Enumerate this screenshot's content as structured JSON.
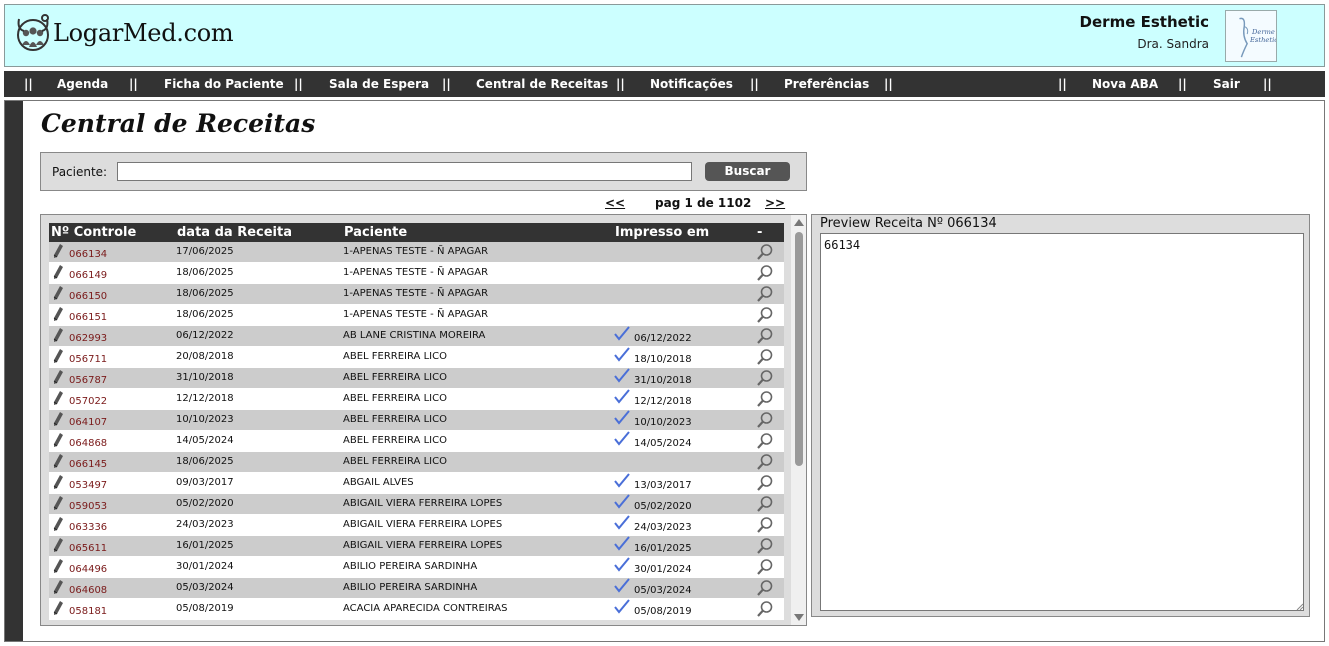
{
  "header": {
    "logo_text": "LogarMed.com",
    "clinic_name": "Derme Esthetic",
    "doctor_name": "Dra. Sandra",
    "clinic_logo_text": "Derme Esthetic"
  },
  "nav": {
    "separator": "||",
    "items": [
      "Agenda",
      "Ficha do Paciente",
      "Sala de Espera",
      "Central de Receitas",
      "Notificações",
      "Preferências"
    ],
    "right_items": [
      "Nova ABA",
      "Sair"
    ]
  },
  "page": {
    "title": "Central de Receitas"
  },
  "search": {
    "label": "Paciente:",
    "value": "",
    "button_label": "Buscar"
  },
  "pager": {
    "prev": "<<",
    "label": "pag 1 de 1102",
    "next": ">>"
  },
  "table": {
    "headers": {
      "controle": "Nº Controle",
      "data": "data da Receita",
      "paciente": "Paciente",
      "impresso": "Impresso em",
      "acao": "-"
    },
    "rows": [
      {
        "controle": "066134",
        "data": "17/06/2025",
        "paciente": "1-APENAS TESTE - Ñ APAGAR",
        "impresso": ""
      },
      {
        "controle": "066149",
        "data": "18/06/2025",
        "paciente": "1-APENAS TESTE - Ñ APAGAR",
        "impresso": ""
      },
      {
        "controle": "066150",
        "data": "18/06/2025",
        "paciente": "1-APENAS TESTE - Ñ APAGAR",
        "impresso": ""
      },
      {
        "controle": "066151",
        "data": "18/06/2025",
        "paciente": "1-APENAS TESTE - Ñ APAGAR",
        "impresso": ""
      },
      {
        "controle": "062993",
        "data": "06/12/2022",
        "paciente": "AB LANE CRISTINA MOREIRA",
        "impresso": "06/12/2022"
      },
      {
        "controle": "056711",
        "data": "20/08/2018",
        "paciente": "ABEL FERREIRA LICO",
        "impresso": "18/10/2018"
      },
      {
        "controle": "056787",
        "data": "31/10/2018",
        "paciente": "ABEL FERREIRA LICO",
        "impresso": "31/10/2018"
      },
      {
        "controle": "057022",
        "data": "12/12/2018",
        "paciente": "ABEL FERREIRA LICO",
        "impresso": "12/12/2018"
      },
      {
        "controle": "064107",
        "data": "10/10/2023",
        "paciente": "ABEL FERREIRA LICO",
        "impresso": "10/10/2023"
      },
      {
        "controle": "064868",
        "data": "14/05/2024",
        "paciente": "ABEL FERREIRA LICO",
        "impresso": "14/05/2024"
      },
      {
        "controle": "066145",
        "data": "18/06/2025",
        "paciente": "ABEL FERREIRA LICO",
        "impresso": ""
      },
      {
        "controle": "053497",
        "data": "09/03/2017",
        "paciente": "ABGAIL ALVES",
        "impresso": "13/03/2017"
      },
      {
        "controle": "059053",
        "data": "05/02/2020",
        "paciente": "ABIGAIL VIERA FERREIRA LOPES",
        "impresso": "05/02/2020"
      },
      {
        "controle": "063336",
        "data": "24/03/2023",
        "paciente": "ABIGAIL VIERA FERREIRA LOPES",
        "impresso": "24/03/2023"
      },
      {
        "controle": "065611",
        "data": "16/01/2025",
        "paciente": "ABIGAIL VIERA FERREIRA LOPES",
        "impresso": "16/01/2025"
      },
      {
        "controle": "064496",
        "data": "30/01/2024",
        "paciente": "ABILIO PEREIRA SARDINHA",
        "impresso": "30/01/2024"
      },
      {
        "controle": "064608",
        "data": "05/03/2024",
        "paciente": "ABILIO PEREIRA SARDINHA",
        "impresso": "05/03/2024"
      },
      {
        "controle": "058181",
        "data": "05/08/2019",
        "paciente": "ACACIA APARECIDA CONTREIRAS",
        "impresso": "05/08/2019"
      }
    ]
  },
  "preview": {
    "title": "Preview Receita Nº 066134",
    "content": "66134"
  },
  "colors": {
    "header_bg": "#ccffff",
    "nav_bg": "#333333",
    "control_number": "#7a1a1a",
    "check": "#4a6fd8"
  }
}
